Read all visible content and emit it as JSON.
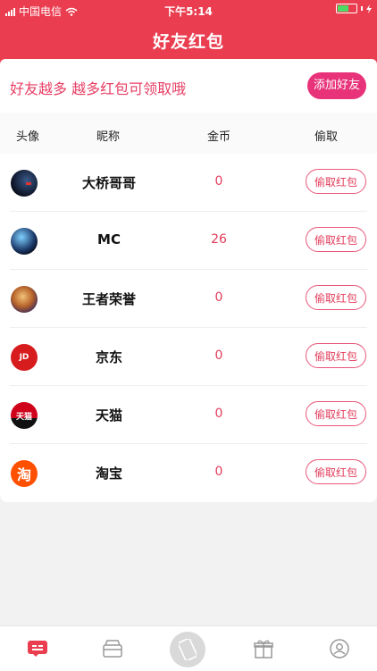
{
  "status_bar": {
    "carrier": "中国电信",
    "time": "下午5:14"
  },
  "header": {
    "title": "好友红包"
  },
  "banner": {
    "slogan": "好友越多 越多红包可领取哦",
    "add_friend_label": "添加好友"
  },
  "columns": {
    "avatar": "头像",
    "nickname": "昵称",
    "coins": "金币",
    "steal": "偷取"
  },
  "friends": [
    {
      "name": "大桥哥哥",
      "coins": "0",
      "steal_label": "偷取红包",
      "avatar_icon": "dark-space-avatar"
    },
    {
      "name": "MC",
      "coins": "26",
      "steal_label": "偷取红包",
      "avatar_icon": "galaxy-avatar"
    },
    {
      "name": "王者荣誉",
      "coins": "0",
      "steal_label": "偷取红包",
      "avatar_icon": "hero-avatar"
    },
    {
      "name": "京东",
      "coins": "0",
      "steal_label": "偷取红包",
      "avatar_icon": "jd-logo",
      "avatar_text": "JD"
    },
    {
      "name": "天猫",
      "coins": "0",
      "steal_label": "偷取红包",
      "avatar_icon": "tmall-logo",
      "avatar_text": "天猫"
    },
    {
      "name": "淘宝",
      "coins": "0",
      "steal_label": "偷取红包",
      "avatar_icon": "taobao-logo",
      "avatar_text": "淘"
    }
  ],
  "tabs": [
    "message-icon",
    "box-icon",
    "phone-center-icon",
    "gift-icon",
    "profile-icon"
  ],
  "colors": {
    "primary": "#ea3e50",
    "accent": "#e8337a",
    "coin": "#e23b5a",
    "battery": "#4cd964"
  }
}
